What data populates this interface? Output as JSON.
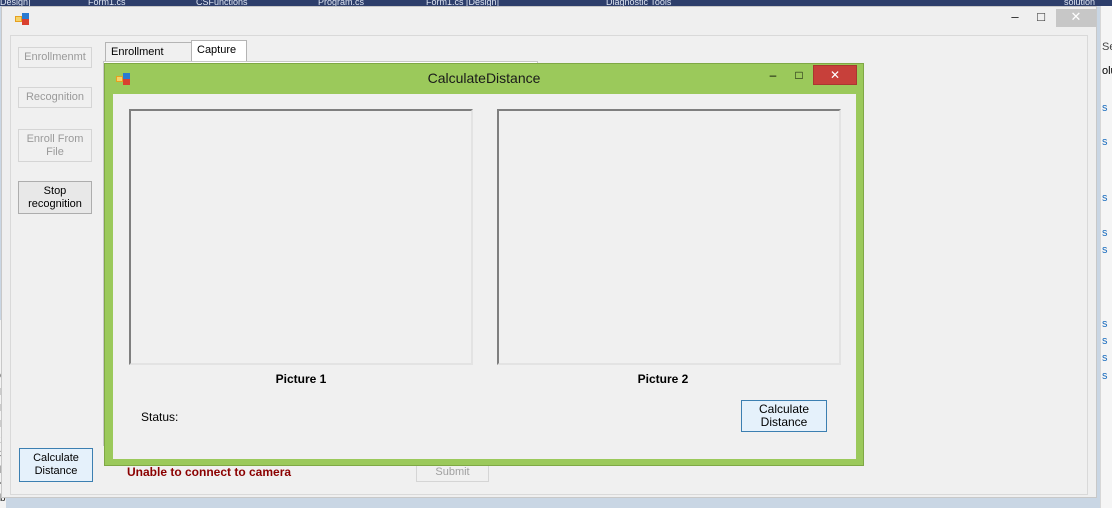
{
  "ide": {
    "tabs": [
      "Design]",
      "Form1.cs",
      "CSFunctions",
      "Program.cs",
      "Form1.cs [Design]",
      "Diagnostic Tools",
      "solution"
    ],
    "right_glyphs": [
      "Se",
      "olu",
      "s",
      "s",
      "s",
      "s",
      "s",
      "s",
      "s",
      "s",
      "s"
    ],
    "left_glyphs": [
      "C",
      "N",
      "N",
      "N",
      "1",
      "3",
      "p",
      "4",
      "b"
    ]
  },
  "main_window": {
    "minimize_glyph": "‒",
    "maximize_glyph": "□",
    "close_glyph": "✕",
    "side_buttons": {
      "enrollment": "Enrollmenmt",
      "recognition": "Recognition",
      "enroll_from_file": "Enroll From File",
      "stop_recognition": "Stop recognition",
      "calculate_distance": "Calculate Distance"
    },
    "tabs": [
      "Enrollment Form",
      "Capture"
    ],
    "camera_status": "Unable to connect to camera",
    "submit_label": "Submit"
  },
  "dialog": {
    "title": "CalculateDistance",
    "minimize_glyph": "‒",
    "maximize_glyph": "□",
    "close_glyph": "✕",
    "picture1_label": "Picture 1",
    "picture2_label": "Picture 2",
    "status_label": "Status:",
    "calculate_label": "Calculate Distance"
  },
  "colors": {
    "dialog_frame": "#9bc95b",
    "close_button": "#c7403a",
    "error_text": "#8b0000",
    "accent_border": "#3c7fb1"
  }
}
